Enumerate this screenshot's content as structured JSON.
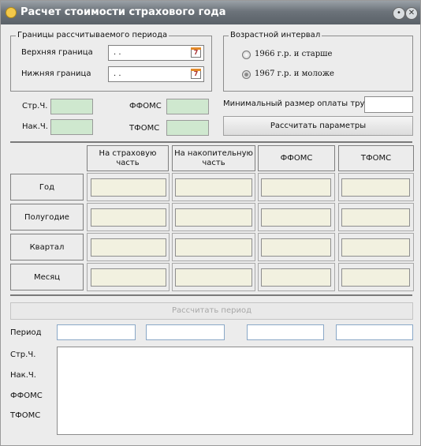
{
  "window": {
    "title": "Расчет стоимости страхового года"
  },
  "period_group": {
    "legend": "Границы рассчитываемого периода",
    "upper_label": "Верхняя граница",
    "upper_value": ". .",
    "lower_label": "Нижняя граница",
    "lower_value": ". .",
    "calendar_glyph": "7"
  },
  "age_group": {
    "legend": "Возрастной интервал",
    "option1": "1966 г.р. и старше",
    "option2": "1967 г.р. и моложе",
    "selected": "option2"
  },
  "params": {
    "str_label": "Стр.Ч.",
    "nak_label": "Нак.Ч.",
    "ffoms_label": "ФФОМС",
    "tfoms_label": "ТФОМС",
    "min_wage_label": "Минимальный размер оплаты труда",
    "calc_params_button": "Рассчитать параметры"
  },
  "table": {
    "columns": [
      "На страховую часть",
      "На накопительную часть",
      "ФФОМС",
      "ТФОМС"
    ],
    "rows": [
      "Год",
      "Полугодие",
      "Квартал",
      "Месяц"
    ]
  },
  "calc_period_button": "Рассчитать период",
  "results": {
    "period_label": "Период",
    "str_label": "Стр.Ч.",
    "nak_label": "Нак.Ч.",
    "ffoms_label": "ФФОМС",
    "tfoms_label": "ТФОМС"
  },
  "colors": {
    "green_field": "#cfe8cf",
    "cell_fill": "#f2f1e0",
    "titlebar": "#6c737a"
  }
}
